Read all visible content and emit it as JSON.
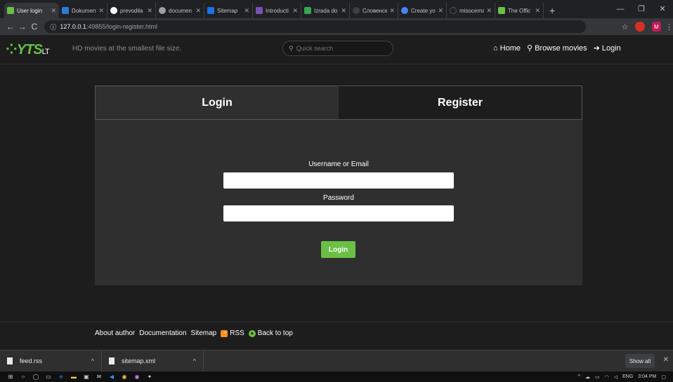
{
  "browser": {
    "tabs": [
      {
        "title": "User login",
        "icon": "yts-icon",
        "color": "#6ac045",
        "active": true
      },
      {
        "title": "Dokument",
        "icon": "word-icon",
        "color": "#2b7cd3"
      },
      {
        "title": "prevodila",
        "icon": "google-icon",
        "color": "#ffffff"
      },
      {
        "title": "documen",
        "icon": "globe-icon",
        "color": "#9aa0a6"
      },
      {
        "title": "Sitemap",
        "icon": "sitemap-icon",
        "color": "#1a73e8"
      },
      {
        "title": "Introducti",
        "icon": "bootstrap-icon",
        "color": "#7952b3"
      },
      {
        "title": "Izrada do",
        "icon": "green-icon",
        "color": "#34a853"
      },
      {
        "title": "Словенск",
        "icon": "dark-icon",
        "color": "#3c4043"
      },
      {
        "title": "Create yo",
        "icon": "blue-icon",
        "color": "#4285f4"
      },
      {
        "title": "misocerna",
        "icon": "github-icon",
        "color": "#202124"
      },
      {
        "title": "The Offic",
        "icon": "yts-icon",
        "color": "#6ac045"
      }
    ],
    "new_tab": "+",
    "url_host": "127.0.0.1",
    "url_path": ":49855/login-register.html",
    "profile_initial": "M"
  },
  "site": {
    "logo": "YTS",
    "logo_suffix": "LT",
    "tagline": "HD movies at the smallest file size.",
    "search_placeholder": "Quick search",
    "nav": {
      "home": "Home",
      "browse": "Browse movies",
      "login": "Login"
    }
  },
  "auth": {
    "tab_login": "Login",
    "tab_register": "Register",
    "username_label": "Username or Email",
    "username_value": "",
    "password_label": "Password",
    "password_value": "",
    "submit_label": "Login"
  },
  "footer": {
    "about": "About author",
    "docs": "Documentation",
    "sitemap": "Sitemap",
    "rss": "RSS",
    "back_to_top": "Back to top"
  },
  "downloads": {
    "items": [
      {
        "name": "feed.rss"
      },
      {
        "name": "sitemap.xml"
      }
    ],
    "show_all": "Show all"
  },
  "taskbar": {
    "lang": "ENG",
    "time": "3:04 PM"
  },
  "colors": {
    "brand_green": "#6ac045",
    "page_bg": "#1d1d1d",
    "panel_bg": "#2f2f2f"
  }
}
